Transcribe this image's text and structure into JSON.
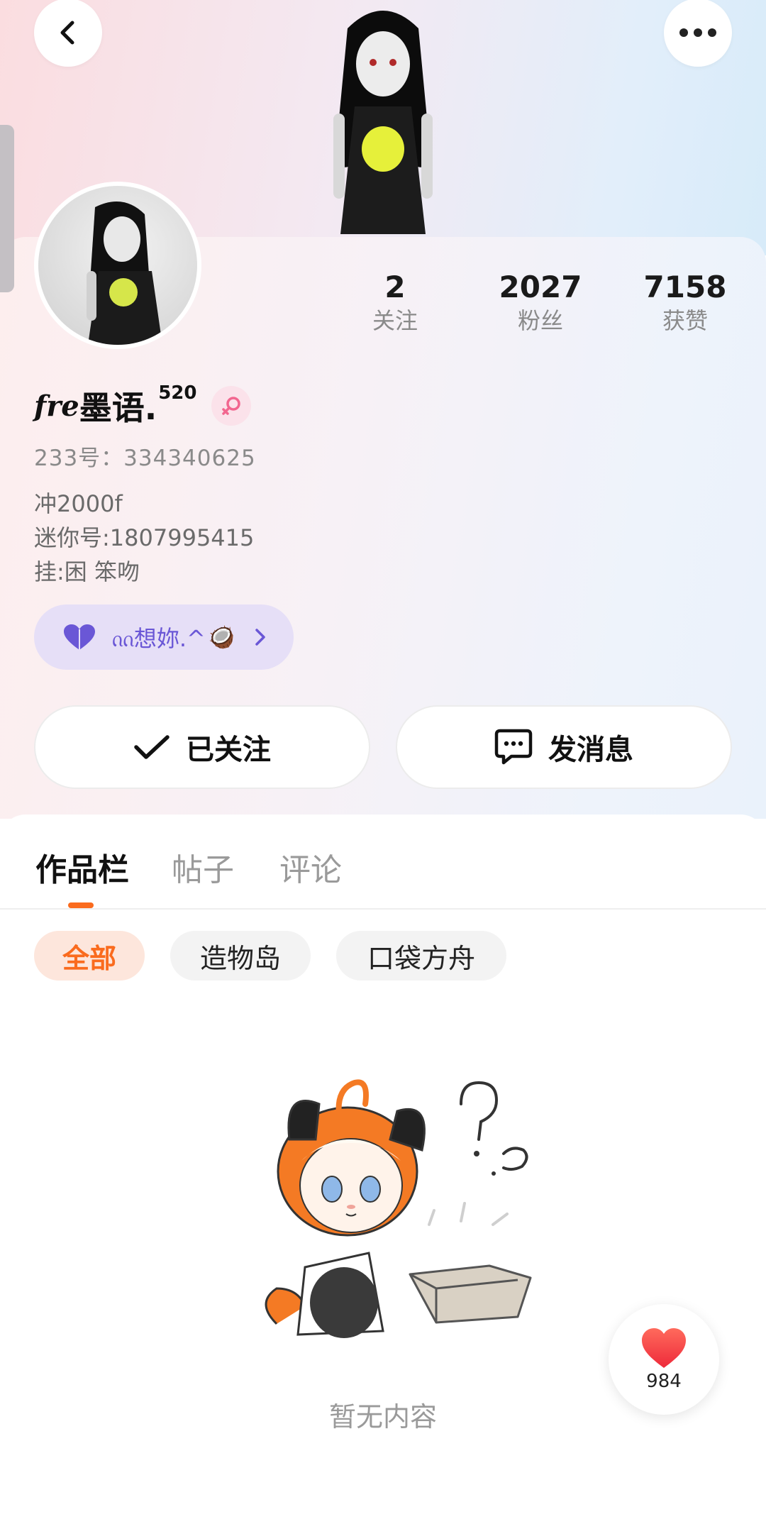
{
  "header": {
    "back_icon": "chevron-left-icon",
    "more_icon": "more-horizontal-icon"
  },
  "stats": [
    {
      "value": "2",
      "label": "关注"
    },
    {
      "value": "2027",
      "label": "粉丝"
    },
    {
      "value": "7158",
      "label": "获赞"
    }
  ],
  "profile": {
    "name_prefix": "fre",
    "name": "墨语.",
    "name_superscript": "520",
    "gender_icon": "female-icon",
    "uid_text": "233号：334340625",
    "bio_lines": [
      "冲2000f",
      "迷你号:1807995415",
      "挂:困 笨吻"
    ]
  },
  "fan_badge": {
    "icon": "heart-icon",
    "text": "ᦶ想妳.^",
    "emoji": "🥥"
  },
  "actions": {
    "follow_label": "已关注",
    "message_label": "发消息"
  },
  "tabs": [
    {
      "label": "作品栏",
      "active": true
    },
    {
      "label": "帖子",
      "active": false
    },
    {
      "label": "评论",
      "active": false
    }
  ],
  "filters": [
    {
      "label": "全部",
      "active": true
    },
    {
      "label": "造物岛",
      "active": false
    },
    {
      "label": "口袋方舟",
      "active": false
    }
  ],
  "empty_state": {
    "text": "暂无内容"
  },
  "like_button": {
    "count": "984"
  },
  "colors": {
    "accent": "#fa6b1e",
    "fan_badge_bg": "#e6dff7",
    "fan_badge_text": "#6a57d6",
    "gender_badge": "#fbe2ea",
    "heart": "#f23a3a"
  }
}
